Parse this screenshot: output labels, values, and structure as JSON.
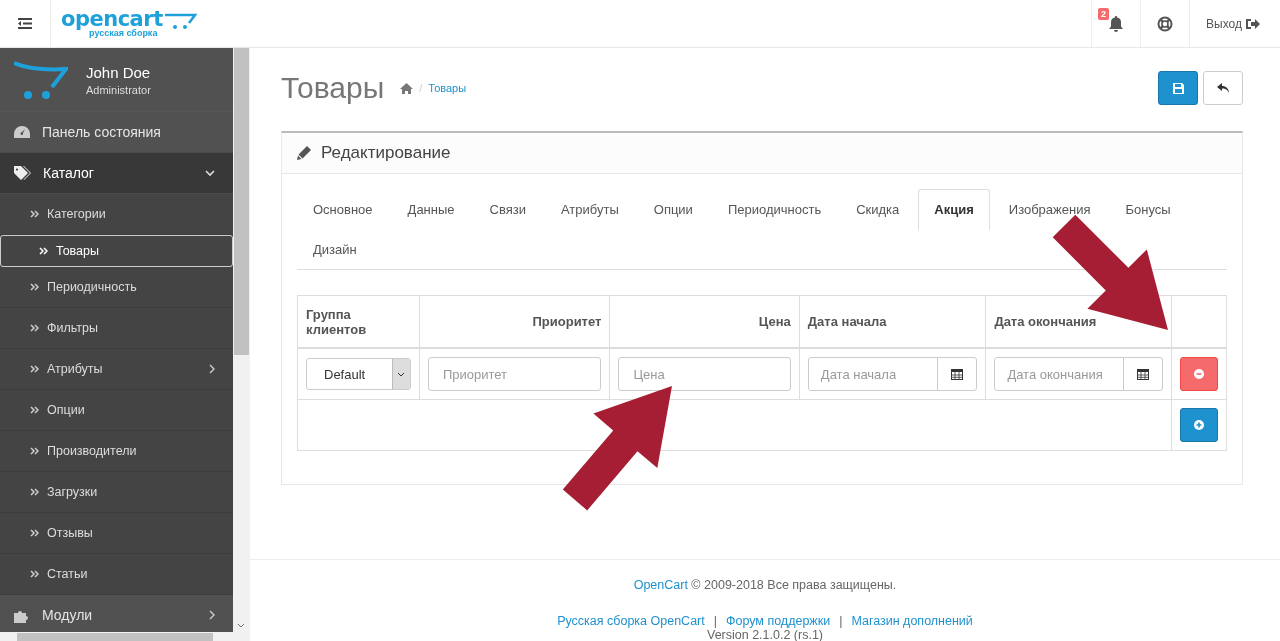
{
  "header": {
    "logo": {
      "name": "opencart",
      "tagline": "русская сборка"
    },
    "notifications": {
      "count": "2"
    },
    "logout": "Выход"
  },
  "sidebar": {
    "user": {
      "name": "John Doe",
      "role": "Administrator"
    },
    "menu": [
      {
        "label": "Панель состояния",
        "kind": "dashboard"
      },
      {
        "label": "Каталог",
        "kind": "catalog",
        "expanded": true,
        "children": [
          {
            "label": "Категории",
            "selected": false
          },
          {
            "label": "Товары",
            "selected": true
          },
          {
            "label": "Периодичность",
            "selected": false
          },
          {
            "label": "Фильтры",
            "selected": false
          },
          {
            "label": "Атрибуты",
            "selected": false,
            "expanded": false
          },
          {
            "label": "Опции",
            "selected": false
          },
          {
            "label": "Производители",
            "selected": false
          },
          {
            "label": "Загрузки",
            "selected": false
          },
          {
            "label": "Отзывы",
            "selected": false
          },
          {
            "label": "Статьи",
            "selected": false
          }
        ]
      },
      {
        "label": "Модули",
        "kind": "modules",
        "expanded": false
      }
    ]
  },
  "page": {
    "title": "Товары",
    "breadcrumb_separator": "/",
    "breadcrumb": [
      "Товары"
    ]
  },
  "panel": {
    "heading": "Редактирование",
    "tabs": [
      {
        "label": "Основное",
        "selected": false
      },
      {
        "label": "Данные",
        "selected": false
      },
      {
        "label": "Связи",
        "selected": false
      },
      {
        "label": "Атрибуты",
        "selected": false
      },
      {
        "label": "Опции",
        "selected": false
      },
      {
        "label": "Периодичность",
        "selected": false
      },
      {
        "label": "Скидка",
        "selected": false
      },
      {
        "label": "Акция",
        "selected": true
      },
      {
        "label": "Изображения",
        "selected": false
      },
      {
        "label": "Бонусы",
        "selected": false
      },
      {
        "label": "Дизайн",
        "selected": false
      }
    ],
    "table": {
      "columns": [
        {
          "label": "Группа клиентов"
        },
        {
          "label": "Приоритет"
        },
        {
          "label": "Цена"
        },
        {
          "label": "Дата начала"
        },
        {
          "label": "Дата окончания"
        }
      ],
      "rows": [
        {
          "customer_group": "Default",
          "priority_placeholder": "Приоритет",
          "price_placeholder": "Цена",
          "date_start_placeholder": "Дата начала",
          "date_end_placeholder": "Дата окончания"
        }
      ]
    }
  },
  "footer": {
    "brand_link": "OpenCart",
    "copyright": "© 2009-2018 Все права защищены.",
    "links": [
      "Русская сборка OpenCart",
      "Форум поддержки",
      "Магазин дополнений"
    ],
    "separator": "|",
    "version": "Version 2.1.0.2 (rs.1)"
  }
}
